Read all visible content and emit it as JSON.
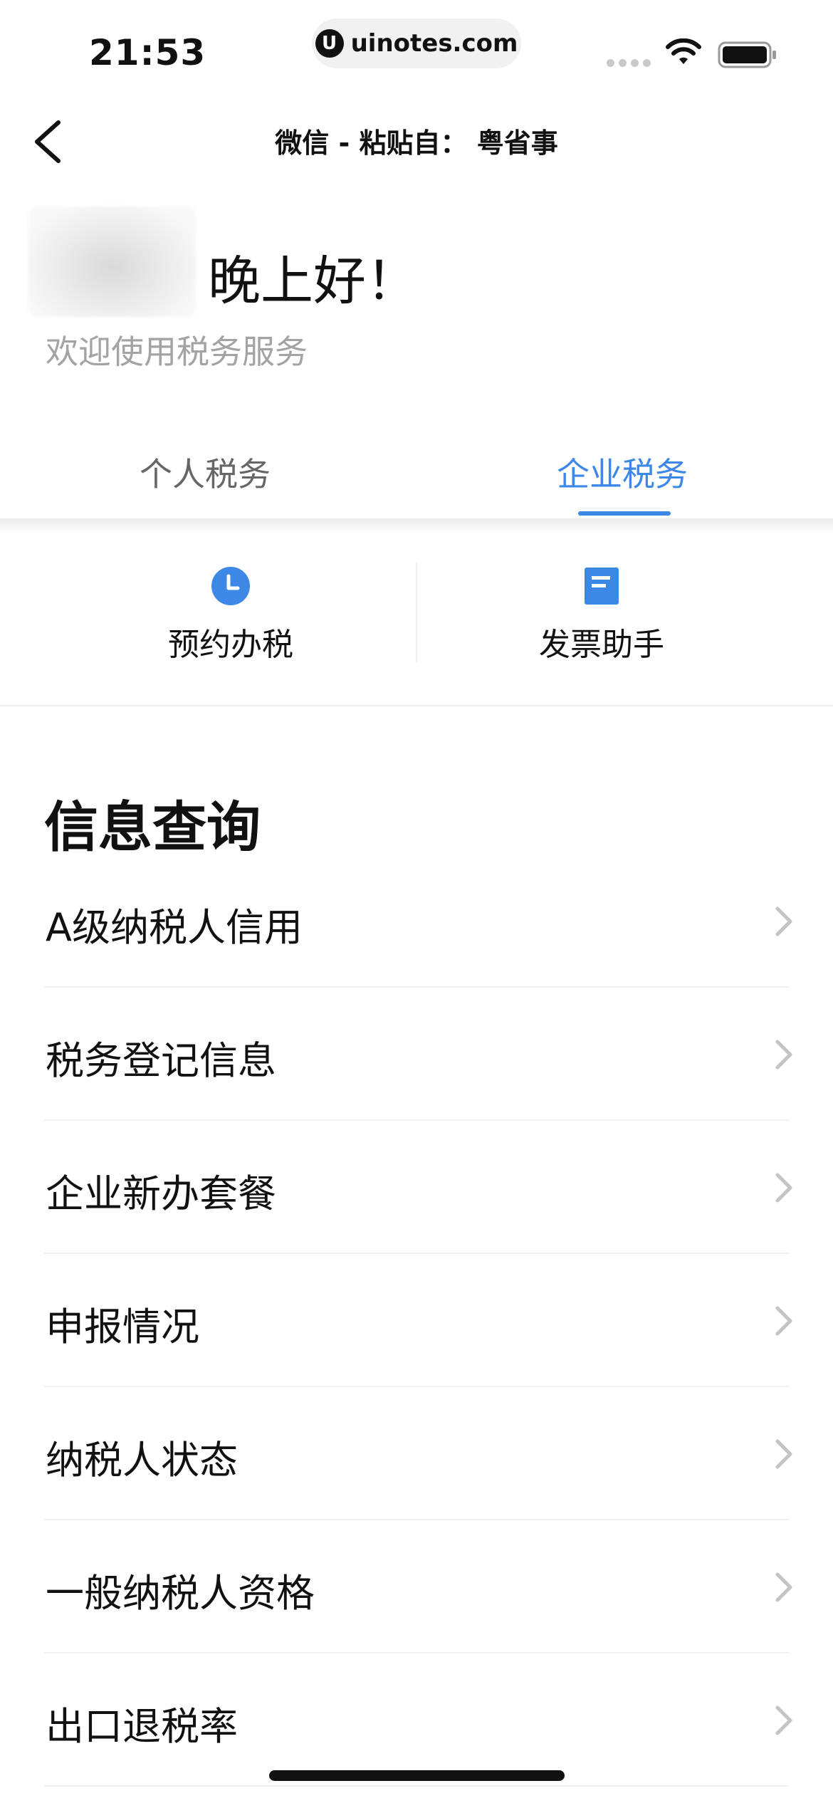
{
  "status_bar": {
    "time": "21:53",
    "url": "uinotes.com",
    "url_logo_letter": "U",
    "icons": [
      "signal-dots-icon",
      "wifi-icon",
      "battery-icon"
    ]
  },
  "nav": {
    "title": "微信 - 粘贴自： 粤省事",
    "back_icon": "chevron-left-icon"
  },
  "greeting": {
    "hello": "晚上好！",
    "welcome": "欢迎使用税务服务"
  },
  "tabs": [
    {
      "label": "个人税务",
      "active": false
    },
    {
      "label": "企业税务",
      "active": true
    }
  ],
  "quick_actions": [
    {
      "label": "预约办税",
      "icon": "clock-icon"
    },
    {
      "label": "发票助手",
      "icon": "document-icon"
    }
  ],
  "section": {
    "title": "信息查询"
  },
  "list": [
    {
      "label": "A级纳税人信用"
    },
    {
      "label": "税务登记信息"
    },
    {
      "label": "企业新办套餐"
    },
    {
      "label": "申报情况"
    },
    {
      "label": "纳税人状态"
    },
    {
      "label": "一般纳税人资格"
    },
    {
      "label": "出口退税率"
    }
  ],
  "colors": {
    "accent": "#3d88e6",
    "text": "#111111",
    "muted": "#a3a3a3"
  }
}
